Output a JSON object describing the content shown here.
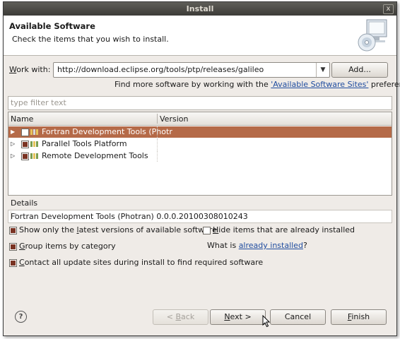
{
  "window": {
    "title": "Install",
    "close": "x"
  },
  "banner": {
    "heading": "Available Software",
    "subtitle": "Check the items that you wish to install."
  },
  "work_with": {
    "label_mnemonic": "W",
    "label_rest": "ork with:",
    "value": "http://download.eclipse.org/tools/ptp/releases/galileo",
    "add_button": "Add..."
  },
  "find_more": {
    "prefix": "Find more software by working with the ",
    "link": "'Available Software Sites'",
    "suffix": " preferences."
  },
  "filter": {
    "placeholder": "type filter text"
  },
  "tree": {
    "columns": [
      "Name",
      "Version"
    ],
    "rows": [
      {
        "name": "Fortran Development Tools (Photr",
        "checked": false,
        "selected": true
      },
      {
        "name": "Parallel Tools Platform",
        "checked": true,
        "selected": false
      },
      {
        "name": "Remote Development Tools",
        "checked": true,
        "selected": false
      }
    ]
  },
  "details": {
    "label": "Details",
    "text": "Fortran Development Tools (Photran) 0.0.0.20100308010243"
  },
  "options": {
    "latest_pre": "Show only the ",
    "latest_mn": "l",
    "latest_post": "atest versions of available software",
    "hide_mn": "H",
    "hide_post": "ide items that are already installed",
    "group_mn": "G",
    "group_post": "roup items by category",
    "what_is": "What is ",
    "already_installed": "already installed",
    "qmark": "?",
    "contact_mn": "C",
    "contact_post": "ontact all update sites during install to find required software"
  },
  "buttons": {
    "help": "?",
    "back_pre": "< ",
    "back_mn": "B",
    "back_post": "ack",
    "next_mn": "N",
    "next_post": "ext >",
    "cancel": "Cancel",
    "finish_mn": "F",
    "finish_post": "inish"
  },
  "colors": {
    "selection": "#b56a48",
    "link": "#1f4c9f",
    "titlebar": "#3c3b37"
  }
}
